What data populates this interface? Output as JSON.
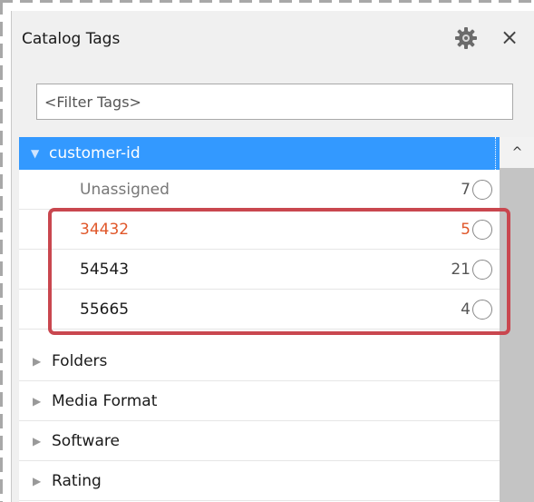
{
  "panel": {
    "title": "Catalog Tags",
    "gear_icon": "gear-icon",
    "close_glyph": "×"
  },
  "filter": {
    "value": "",
    "placeholder": "<Filter Tags>"
  },
  "tree": {
    "selected_group": "customer-id",
    "children": [
      {
        "label": "Unassigned",
        "count": "7"
      },
      {
        "label": "34432",
        "count": "5"
      },
      {
        "label": "54543",
        "count": "21"
      },
      {
        "label": "55665",
        "count": "4"
      }
    ],
    "groups": [
      {
        "label": "Folders"
      },
      {
        "label": "Media Format"
      },
      {
        "label": "Software"
      },
      {
        "label": "Rating"
      }
    ]
  },
  "colors": {
    "selection": "#3399ff",
    "highlight_text": "#e0572a",
    "annotation_box": "#c9474f"
  }
}
